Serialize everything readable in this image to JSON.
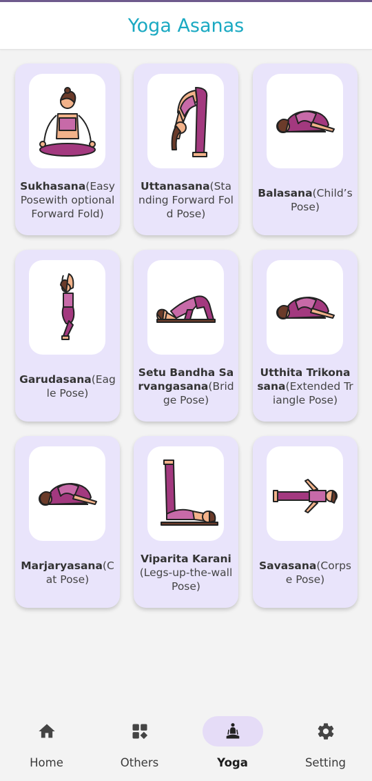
{
  "appbar": {
    "title": "Yoga Asanas"
  },
  "poses": [
    {
      "name": "Sukhasana",
      "desc": "(Easy Posewith optional Forward Fold)",
      "icon": "sukhasana-figure-icon"
    },
    {
      "name": "Uttanasana",
      "desc": "(Standing Forward Fold Pose)",
      "icon": "uttanasana-figure-icon"
    },
    {
      "name": "Balasana",
      "desc": "(Child’s Pose)",
      "icon": "balasana-figure-icon"
    },
    {
      "name": "Garudasana",
      "desc": "(Eagle Pose)",
      "icon": "garudasana-figure-icon"
    },
    {
      "name": "Setu Bandha Sarvangasana",
      "desc": "(Bridge Pose)",
      "icon": "setu-bandha-figure-icon"
    },
    {
      "name": "Utthita Trikonasana",
      "desc": "(Extended Triangle Pose)",
      "icon": "trikonasana-figure-icon"
    },
    {
      "name": "Marjaryasana",
      "desc": "(Cat Pose)",
      "icon": "marjaryasana-figure-icon"
    },
    {
      "name": "Viparita Karani",
      "desc": "(Legs-up-the-wall Pose)",
      "icon": "viparita-karani-figure-icon"
    },
    {
      "name": "Savasana",
      "desc": "(Corpse Pose)",
      "icon": "savasana-figure-icon"
    }
  ],
  "nav": [
    {
      "label": "Home",
      "icon": "home-icon",
      "active": false
    },
    {
      "label": "Others",
      "icon": "grid-icon",
      "active": false
    },
    {
      "label": "Yoga",
      "icon": "meditation-icon",
      "active": true
    },
    {
      "label": "Setting",
      "icon": "gear-icon",
      "active": false
    }
  ],
  "colors": {
    "accent": "#1aa9c2",
    "card": "#e9e4fb",
    "figure": "#a3397f",
    "skin": "#f2b28a",
    "hair": "#6b3b2a",
    "active_pill": "#e5dcf7"
  }
}
